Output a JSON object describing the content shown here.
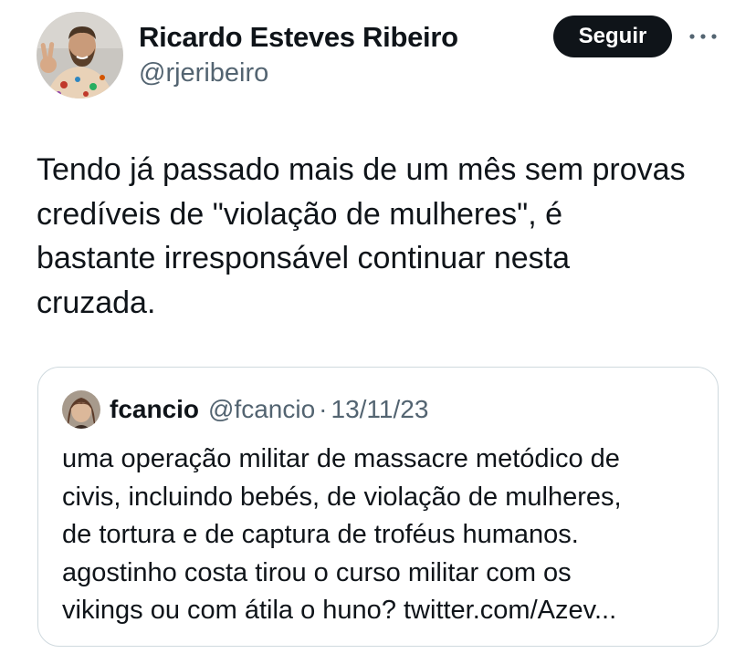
{
  "author": {
    "name": "Ricardo Esteves Ribeiro",
    "handle": "@rjeribeiro"
  },
  "actions": {
    "follow_label": "Seguir",
    "more_icon": "more-horizontal-icon"
  },
  "tweet": {
    "text": "Tendo já passado mais de um mês sem provas\ncredíveis de \"violação de mulheres\", é\nbastante irresponsável continuar nesta\ncruzada."
  },
  "quoted": {
    "name": "fcancio",
    "handle": "@fcancio",
    "separator": "·",
    "date": "13/11/23",
    "text": "uma operação militar de massacre metódico de\ncivis, incluindo bebés, de violação de mulheres,\nde tortura e de captura de troféus humanos.\nagostinho costa tirou o curso militar com os\nvikings ou com átila o huno? twitter.com/Azev..."
  },
  "colors": {
    "text": "#0f1419",
    "secondary": "#536471",
    "border": "#cfd9de",
    "button_bg": "#0f1419",
    "button_text": "#ffffff"
  }
}
